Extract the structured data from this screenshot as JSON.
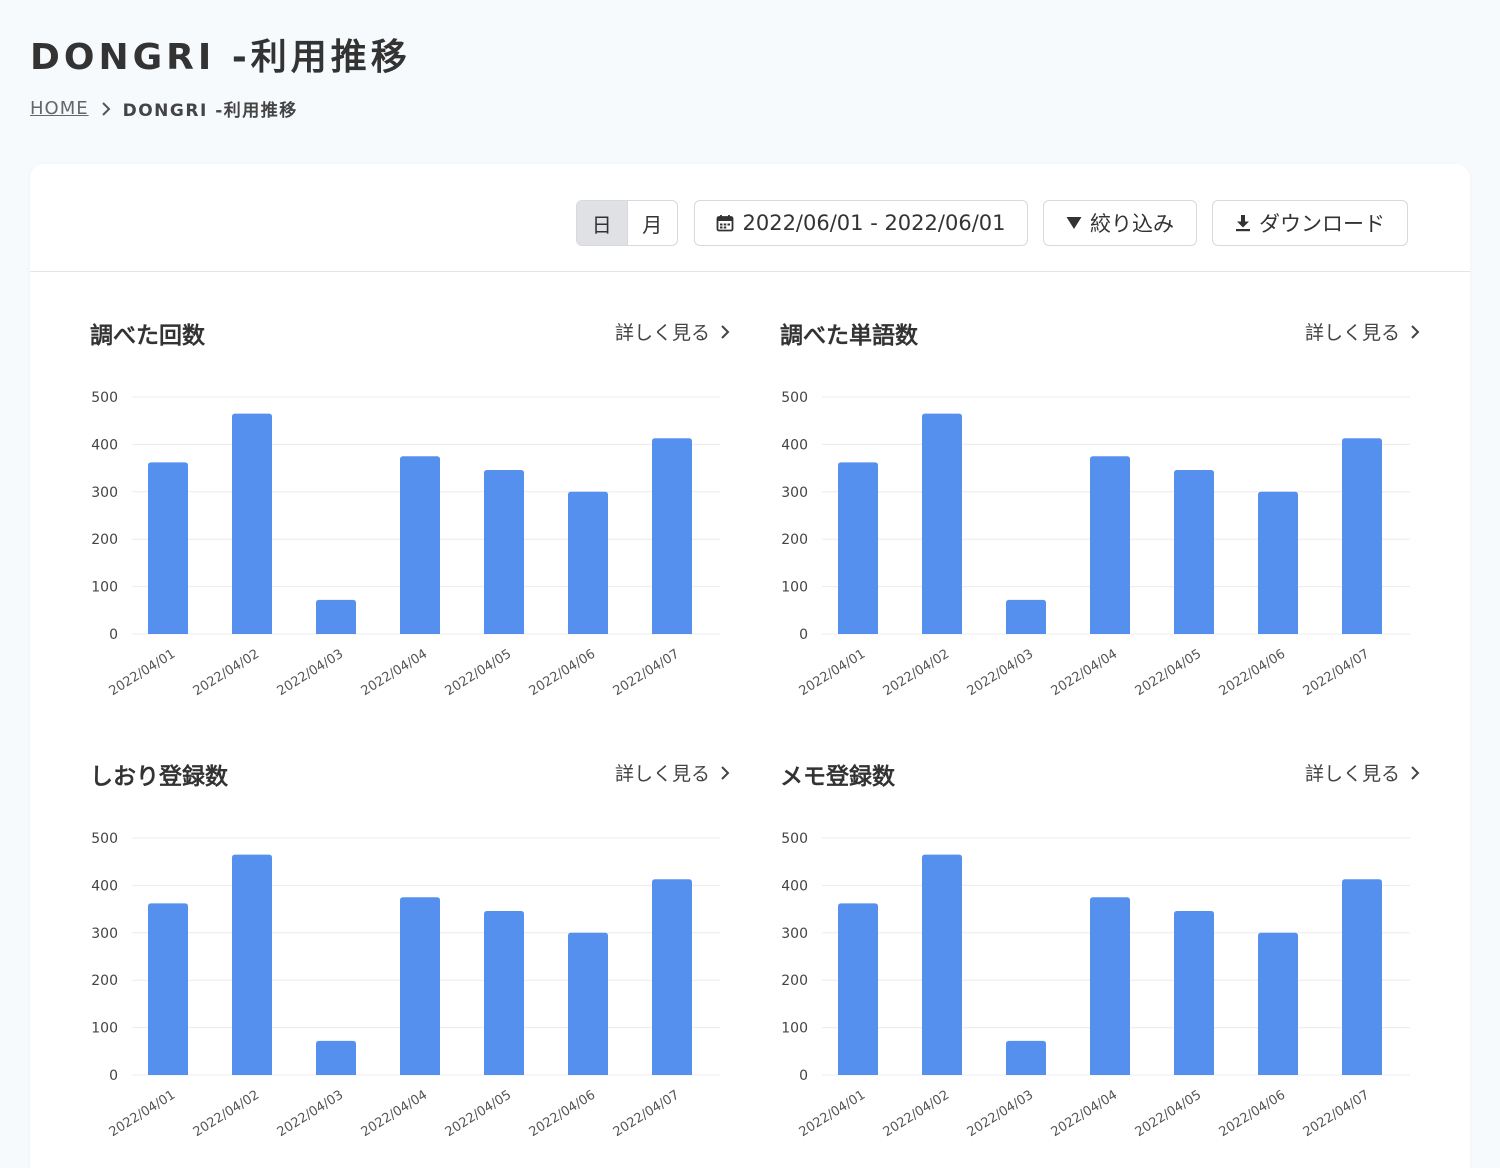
{
  "page": {
    "title": "DONGRI -利用推移",
    "breadcrumb": {
      "home": "HOME",
      "current": "DONGRI -利用推移"
    }
  },
  "toolbar": {
    "period_day": "日",
    "period_month": "月",
    "date_range": "2022/06/01 - 2022/06/01",
    "filter_label": "絞り込み",
    "download_label": "ダウンロード"
  },
  "colors": {
    "bar": "#5590ee",
    "grid": "#ececec"
  },
  "charts": [
    {
      "title": "調べた回数",
      "more": "詳しく見る"
    },
    {
      "title": "調べた単語数",
      "more": "詳しく見る"
    },
    {
      "title": "しおり登録数",
      "more": "詳しく見る"
    },
    {
      "title": "メモ登録数",
      "more": "詳しく見る"
    }
  ],
  "chart_data": [
    {
      "type": "bar",
      "title": "調べた回数",
      "categories": [
        "2022/04/01",
        "2022/04/02",
        "2022/04/03",
        "2022/04/04",
        "2022/04/05",
        "2022/04/06",
        "2022/04/07"
      ],
      "values": [
        362,
        465,
        72,
        375,
        346,
        300,
        413
      ],
      "ylim": [
        0,
        500
      ],
      "yticks": [
        0,
        100,
        200,
        300,
        400,
        500
      ],
      "grid": true
    },
    {
      "type": "bar",
      "title": "調べた単語数",
      "categories": [
        "2022/04/01",
        "2022/04/02",
        "2022/04/03",
        "2022/04/04",
        "2022/04/05",
        "2022/04/06",
        "2022/04/07"
      ],
      "values": [
        362,
        465,
        72,
        375,
        346,
        300,
        413
      ],
      "ylim": [
        0,
        500
      ],
      "yticks": [
        0,
        100,
        200,
        300,
        400,
        500
      ],
      "grid": true
    },
    {
      "type": "bar",
      "title": "しおり登録数",
      "categories": [
        "2022/04/01",
        "2022/04/02",
        "2022/04/03",
        "2022/04/04",
        "2022/04/05",
        "2022/04/06",
        "2022/04/07"
      ],
      "values": [
        362,
        465,
        72,
        375,
        346,
        300,
        413
      ],
      "ylim": [
        0,
        500
      ],
      "yticks": [
        0,
        100,
        200,
        300,
        400,
        500
      ],
      "grid": true
    },
    {
      "type": "bar",
      "title": "メモ登録数",
      "categories": [
        "2022/04/01",
        "2022/04/02",
        "2022/04/03",
        "2022/04/04",
        "2022/04/05",
        "2022/04/06",
        "2022/04/07"
      ],
      "values": [
        362,
        465,
        72,
        375,
        346,
        300,
        413
      ],
      "ylim": [
        0,
        500
      ],
      "yticks": [
        0,
        100,
        200,
        300,
        400,
        500
      ],
      "grid": true
    }
  ]
}
